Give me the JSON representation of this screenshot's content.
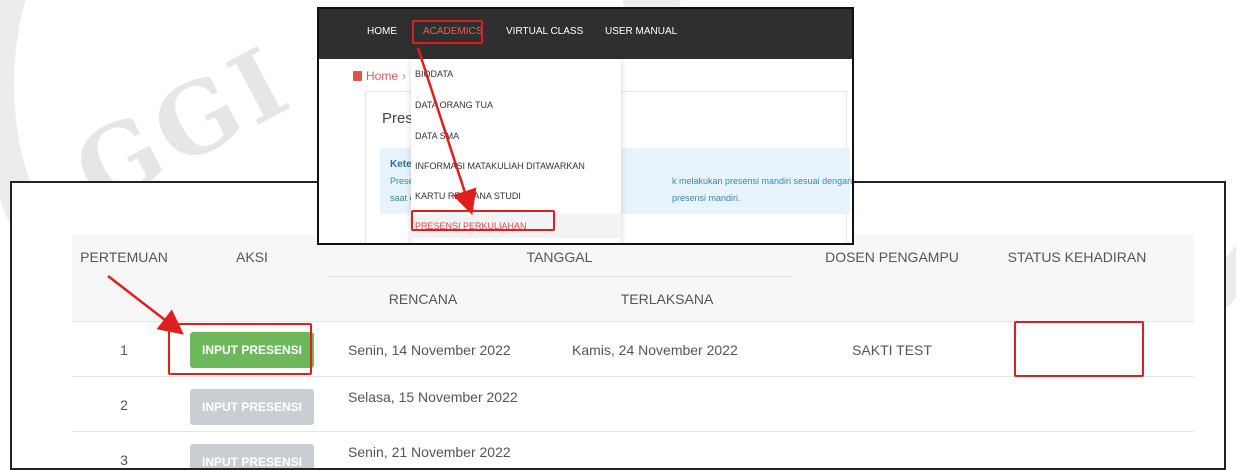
{
  "navbar": {
    "items": [
      {
        "label": "HOME"
      },
      {
        "label": "ACADEMICS"
      },
      {
        "label": "VIRTUAL CLASS"
      },
      {
        "label": "USER MANUAL"
      }
    ]
  },
  "breadcrumb": {
    "home": "Home",
    "sep": "›"
  },
  "page": {
    "title_partial": "Prese",
    "info_title_partial": "Keter",
    "info_line1_left": "Prese",
    "info_line1_right": "k melakukan presensi mandiri sesuai dengan kelas perk",
    "info_line2_left": "saat c",
    "info_line2_right": "presensi mandiri."
  },
  "dropdown": {
    "items": [
      {
        "label": "BIODATA"
      },
      {
        "label": "DATA ORANG TUA"
      },
      {
        "label": "DATA SMA"
      },
      {
        "label": "INFORMASI MATAKULIAH DITAWARKAN"
      },
      {
        "label": "KARTU RENCANA STUDI"
      },
      {
        "label": "PRESENSI PERKULIAHAN"
      }
    ]
  },
  "table": {
    "headers": {
      "pertemuan": "PERTEMUAN",
      "aksi": "AKSI",
      "tanggal": "TANGGAL",
      "rencana": "RENCANA",
      "terlaksana": "TERLAKSANA",
      "dosen": "DOSEN PENGAMPU",
      "status": "STATUS KEHADIRAN"
    },
    "rows": [
      {
        "pertemuan": "1",
        "button": "INPUT PRESENSI",
        "rencana": "Senin, 14 November 2022",
        "terlaksana": "Kamis, 24 November 2022",
        "dosen": "SAKTI TEST",
        "status": ""
      },
      {
        "pertemuan": "2",
        "button": "INPUT PRESENSI",
        "rencana": "Selasa, 15 November 2022",
        "terlaksana": "",
        "dosen": "",
        "status": ""
      },
      {
        "pertemuan": "3",
        "button": "INPUT PRESENSI",
        "rencana": "Senin, 21 November 2022",
        "terlaksana": "",
        "dosen": "",
        "status": ""
      }
    ]
  },
  "watermark": {
    "text": "GGI"
  },
  "colors": {
    "highlight": "#e01e1e",
    "button_active": "#6cb85a",
    "button_disabled": "#c9ced3",
    "navbar_bg": "#2f2f2f",
    "nav_active": "#f05a5a"
  }
}
